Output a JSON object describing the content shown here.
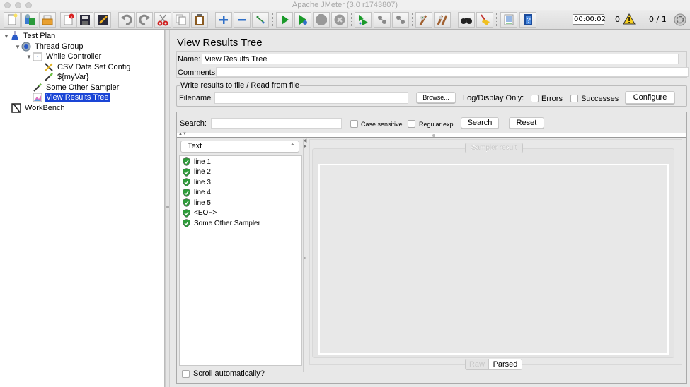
{
  "window": {
    "title": "Apache JMeter (3.0 r1743807)"
  },
  "toolbar": {
    "buttons": [
      {
        "name": "new-icon",
        "label": "New"
      },
      {
        "name": "templates-icon",
        "label": "Templates"
      },
      {
        "name": "open-icon",
        "label": "Open"
      },
      {
        "name": "close-icon",
        "label": "Close"
      },
      {
        "name": "save-icon",
        "label": "Save"
      },
      {
        "name": "save-as-icon",
        "label": "Save as"
      },
      {
        "name": "undo-icon",
        "label": "Undo"
      },
      {
        "name": "redo-icon",
        "label": "Redo"
      },
      {
        "name": "cut-icon",
        "label": "Cut"
      },
      {
        "name": "copy-icon",
        "label": "Copy"
      },
      {
        "name": "paste-icon",
        "label": "Paste"
      },
      {
        "name": "expand-icon",
        "label": "Expand all"
      },
      {
        "name": "collapse-icon",
        "label": "Collapse all"
      },
      {
        "name": "toggle-icon",
        "label": "Toggle"
      },
      {
        "name": "start-icon",
        "label": "Start"
      },
      {
        "name": "start-no-pauses-icon",
        "label": "Start no pauses"
      },
      {
        "name": "stop-icon",
        "label": "Stop"
      },
      {
        "name": "shutdown-icon",
        "label": "Shutdown"
      },
      {
        "name": "remote-start-icon",
        "label": "Remote start all"
      },
      {
        "name": "remote-stop-icon",
        "label": "Remote stop all"
      },
      {
        "name": "remote-shutdown-icon",
        "label": "Remote shutdown all"
      },
      {
        "name": "clear-icon",
        "label": "Clear"
      },
      {
        "name": "clear-all-icon",
        "label": "Clear all"
      },
      {
        "name": "search-icon",
        "label": "Search"
      },
      {
        "name": "reset-search-icon",
        "label": "Reset search"
      },
      {
        "name": "function-helper-icon",
        "label": "Function helper"
      },
      {
        "name": "help-icon",
        "label": "Help"
      }
    ],
    "elapsed_time": "00:00:02",
    "error_count": "0",
    "threads": "0 / 1"
  },
  "tree": {
    "nodes": [
      {
        "label": "Test Plan",
        "icon": "test-plan-icon",
        "level": 0,
        "expanded": true
      },
      {
        "label": "Thread Group",
        "icon": "thread-group-icon",
        "level": 1,
        "expanded": true
      },
      {
        "label": "While Controller",
        "icon": "while-controller-icon",
        "level": 2,
        "expanded": true
      },
      {
        "label": "CSV Data Set Config",
        "icon": "config-icon",
        "level": 3
      },
      {
        "label": "${myVar}",
        "icon": "sampler-icon",
        "level": 3
      },
      {
        "label": "Some Other Sampler",
        "icon": "sampler-icon",
        "level": 2
      },
      {
        "label": "View Results Tree",
        "icon": "listener-icon",
        "level": 2,
        "selected": true
      },
      {
        "label": "WorkBench",
        "icon": "workbench-icon",
        "level": 0
      }
    ]
  },
  "panel": {
    "title": "View Results Tree",
    "name_label": "Name:",
    "name_value": "View Results Tree",
    "comments_label": "Comments:",
    "comments_value": "",
    "file_group_legend": "Write results to file / Read from file",
    "filename_label": "Filename",
    "filename_value": "",
    "browse_label": "Browse...",
    "log_display_label": "Log/Display Only:",
    "errors_label": "Errors",
    "successes_label": "Successes",
    "configure_label": "Configure"
  },
  "search": {
    "label": "Search:",
    "value": "",
    "case_sensitive_label": "Case sensitive",
    "regex_label": "Regular exp.",
    "search_button": "Search",
    "reset_button": "Reset"
  },
  "results": {
    "renderer": "Text",
    "items": [
      {
        "label": "line 1",
        "status": "success"
      },
      {
        "label": "line 2",
        "status": "success"
      },
      {
        "label": "line 3",
        "status": "success"
      },
      {
        "label": "line 4",
        "status": "success"
      },
      {
        "label": "line 5",
        "status": "success"
      },
      {
        "label": "<EOF>",
        "status": "success"
      },
      {
        "label": "Some Other Sampler",
        "status": "success"
      }
    ],
    "scroll_auto_label": "Scroll automatically?",
    "sampler_tab_label": "Sampler result",
    "raw_label": "Raw",
    "parsed_label": "Parsed",
    "success_color": "#2e9c3a",
    "selection_color": "#1a45d6"
  }
}
